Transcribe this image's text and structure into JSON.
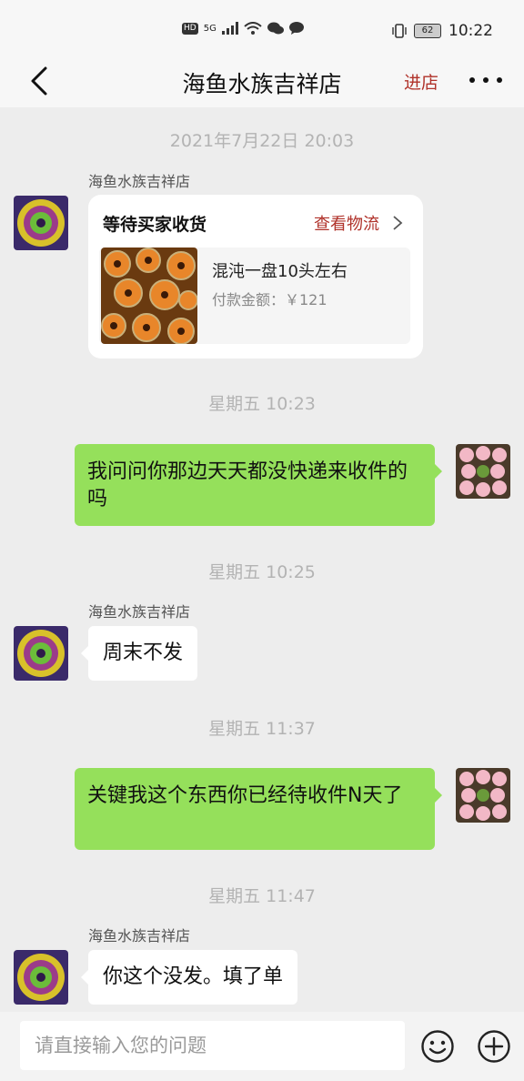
{
  "status_bar": {
    "hd": "HD",
    "net": "5G",
    "battery": "62",
    "time": "10:22"
  },
  "nav": {
    "title": "海鱼水族吉祥店",
    "enter_shop": "进店"
  },
  "messages": {
    "ts1": "2021年7月22日 20:03",
    "sender1": "海鱼水族吉祥店",
    "order": {
      "status": "等待买家收货",
      "logistics": "查看物流",
      "product": "混沌一盘10头左右",
      "price": "付款金额：￥121"
    },
    "ts2": "星期五 10:23",
    "out1": "我问问你那边天天都没快递来收件的吗",
    "ts3": "星期五 10:25",
    "sender2": "海鱼水族吉祥店",
    "in1": "周末不发",
    "ts4": "星期五 11:37",
    "out2": "关键我这个东西你已经待收件N天了",
    "ts5": "星期五 11:47",
    "sender3": "海鱼水族吉祥店",
    "in2": "你这个没发。填了单"
  },
  "input": {
    "placeholder": "请直接输入您的问题"
  },
  "colors": {
    "accent": "#b0322a",
    "bubble_out": "#95e05b",
    "background": "#ededed"
  },
  "icons": [
    "back-arrow-icon",
    "more-dots-icon",
    "chevron-right-icon",
    "emoji-icon",
    "plus-circle-icon"
  ]
}
